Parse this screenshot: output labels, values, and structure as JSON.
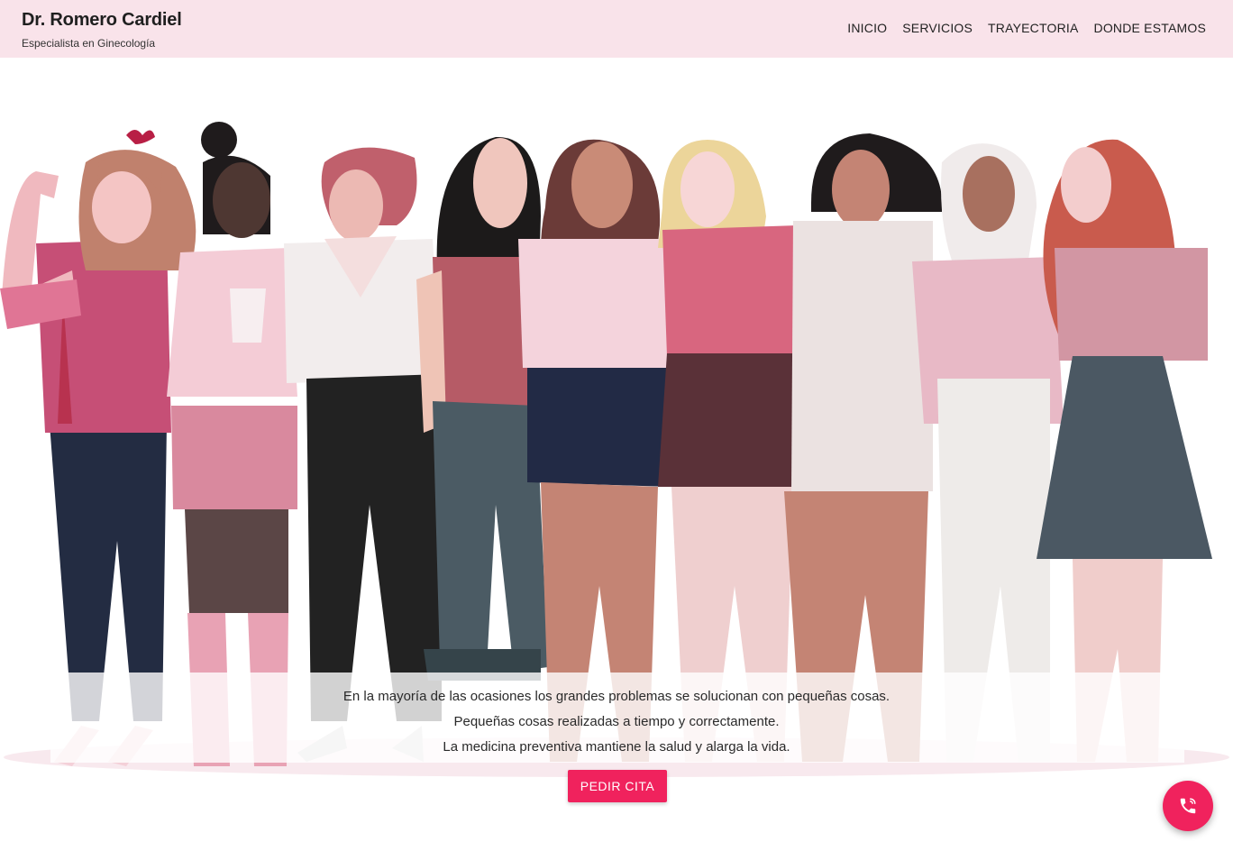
{
  "header": {
    "title": "Dr. Romero Cardiel",
    "subtitle": "Especialista en Ginecología"
  },
  "nav": {
    "items": [
      {
        "label": "INICIO"
      },
      {
        "label": "SERVICIOS"
      },
      {
        "label": "TRAYECTORIA"
      },
      {
        "label": "DONDE ESTAMOS"
      }
    ]
  },
  "hero": {
    "lines": [
      "En la mayoría de las ocasiones los grandes problemas se solucionan con pequeñas cosas.",
      "Pequeñas cosas realizadas a tiempo y correctamente.",
      "La medicina preventiva mantiene la salud y alarga la vida."
    ],
    "cta_label": "PEDIR CITA"
  },
  "icons": {
    "fab": "phone-call-icon"
  },
  "colors": {
    "header_bg": "#f9e3ea",
    "accent": "#f0225d"
  }
}
